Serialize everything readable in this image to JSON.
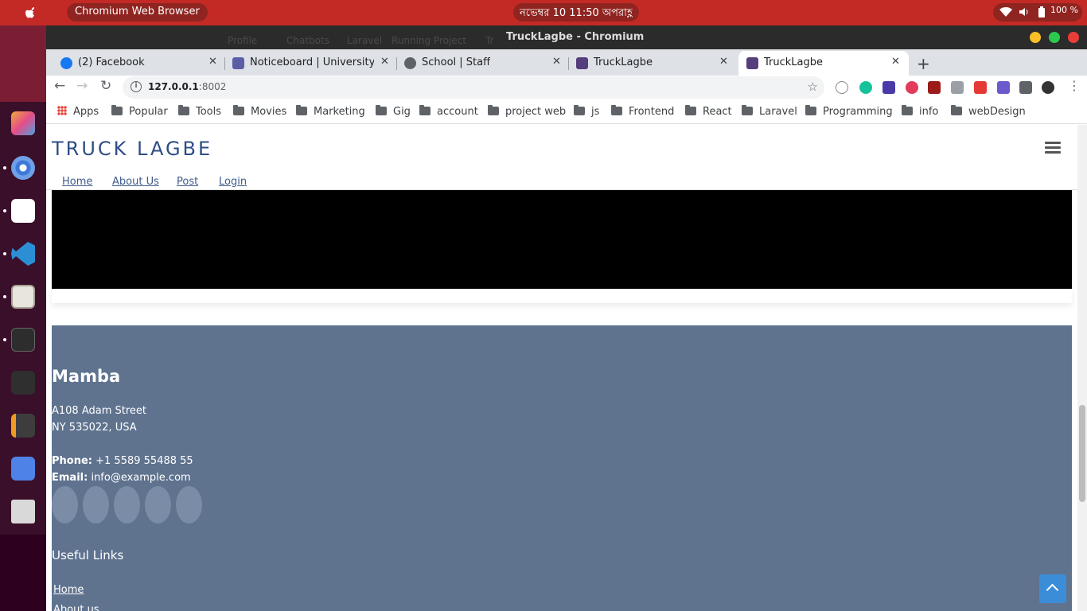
{
  "os": {
    "app_title": "Chromium Web Browser",
    "clock": "নভেম্বর 10  11:50 অপরাহ্ণ",
    "battery": "100 %",
    "dock_items": [
      "app-grid-icon",
      "chromium-icon",
      "text-editor-icon",
      "vscode-icon",
      "files-icon",
      "terminal-icon",
      "system-monitor-icon",
      "sublime-icon",
      "screenshot-icon",
      "trash-icon"
    ]
  },
  "window": {
    "title": "TruckLagbe - Chromium",
    "ghost_tabs": [
      "Profile",
      "Chatbots",
      "Laravel",
      "Running Project",
      "Tr"
    ]
  },
  "tabs": [
    {
      "label": "(2) Facebook",
      "favicon_color": "#1877f2"
    },
    {
      "label": "Noticeboard | University o",
      "favicon_color": "#5b5ea6"
    },
    {
      "label": "School | Staff",
      "favicon_color": "#5f6368"
    },
    {
      "label": "TruckLagbe",
      "favicon_color": "#563d7c"
    },
    {
      "label": "TruckLagbe",
      "favicon_color": "#563d7c",
      "active": true
    }
  ],
  "address_bar": {
    "host": "127.0.0.1",
    "port": ":8002"
  },
  "bookmarks": [
    "Apps",
    "Popular",
    "Tools",
    "Movies",
    "Marketing",
    "Gig",
    "account",
    "project web",
    "js",
    "Frontend",
    "React",
    "Laravel",
    "Programming",
    "info",
    "webDesign"
  ],
  "site": {
    "brand": "TRUCK LAGBE",
    "menu": [
      "Home",
      "About Us",
      "Post",
      "Login"
    ],
    "footer": {
      "company": "Mamba",
      "address_line1": "A108 Adam Street",
      "address_line2": "NY 535022, USA",
      "phone_label": "Phone:",
      "phone": "+1 5589 55488 55",
      "email_label": "Email:",
      "email": "info@example.com",
      "useful_links_title": "Useful Links",
      "links": [
        "Home",
        "About us"
      ]
    }
  },
  "colors": {
    "topbar": "#c42a25",
    "brand": "#2e4d85",
    "footer_bg": "#5f738f",
    "back_to_top": "#3b8dd8"
  }
}
